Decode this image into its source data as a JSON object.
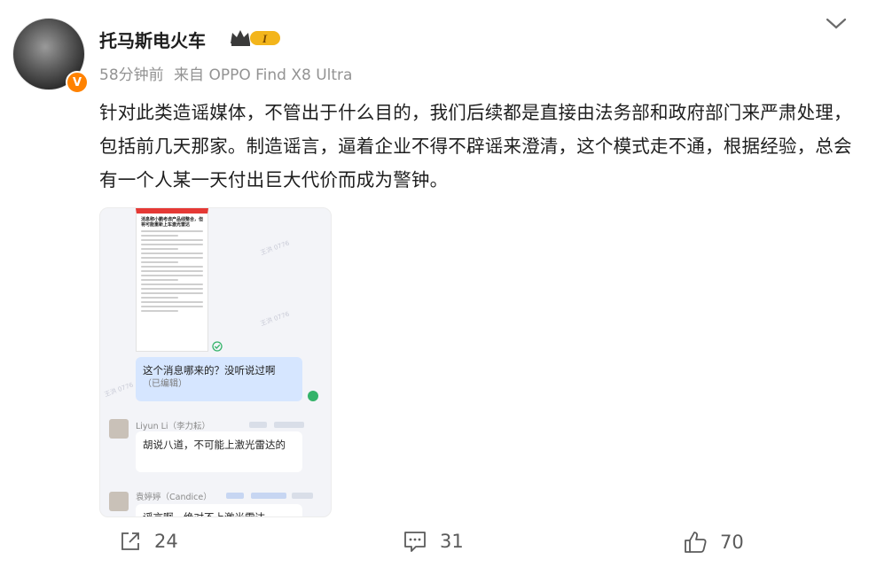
{
  "post": {
    "username": "托马斯电火车",
    "vip_badge_text": "I",
    "verified_badge_text": "V",
    "time": "58分钟前",
    "source": "来自 OPPO Find X8 Ultra",
    "text": "针对此类造谣媒体，不管出于什么目的，我们后续都是直接由法务部和政府部门来严肃处理，包括前几天那家。制造谣言，逼着企业不得不辟谣来澄清，这个模式走不通，根据经验，总会有一个人某一天付出巨大代价而成为警钟。"
  },
  "image": {
    "doc_title": "消息称小鹏考虑产品线整合，但将可能重新上车激光雷达",
    "bubble1_text": "这个消息哪来的？没听说过啊",
    "bubble1_edited": "（已编辑）",
    "sender1": "Liyun Li（李力耘）",
    "bubble2_text": "胡说八道，不可能上激光雷达的",
    "sender2": "袁婷婷（Candice）",
    "bubble3_text": "谣言啊，绝对不上激光雷达"
  },
  "actions": {
    "repost_count": "24",
    "comment_count": "31",
    "like_count": "70"
  },
  "colors": {
    "verified": "#ff8200",
    "bubble_blue": "#d6e6ff",
    "text_main": "#1e1e1e",
    "text_meta": "#939393"
  },
  "icons": [
    "crown-icon",
    "chevron-down-icon",
    "repost-icon",
    "comment-icon",
    "like-icon"
  ]
}
